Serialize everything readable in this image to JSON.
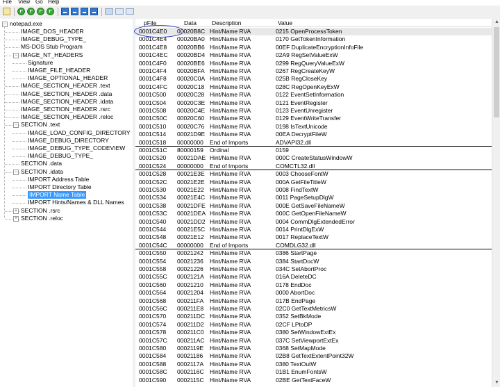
{
  "menu": [
    "File",
    "View",
    "Go",
    "Help"
  ],
  "tree": {
    "root": "notepad.exe",
    "items": [
      {
        "label": "IMAGE_DOS_HEADER",
        "level": 1
      },
      {
        "label": "IMAGE_DEBUG_TYPE_",
        "level": 1
      },
      {
        "label": "MS-DOS Stub Program",
        "level": 1
      },
      {
        "label": "IMAGE_NT_HEADERS",
        "level": 1
      },
      {
        "label": "Signature",
        "level": 2
      },
      {
        "label": "IMAGE_FILE_HEADER",
        "level": 2
      },
      {
        "label": "IMAGE_OPTIONAL_HEADER",
        "level": 2
      },
      {
        "label": "IMAGE_SECTION_HEADER .text",
        "level": 1
      },
      {
        "label": "IMAGE_SECTION_HEADER .data",
        "level": 1
      },
      {
        "label": "IMAGE_SECTION_HEADER .idata",
        "level": 1
      },
      {
        "label": "IMAGE_SECTION_HEADER .rsrc",
        "level": 1
      },
      {
        "label": "IMAGE_SECTION_HEADER .reloc",
        "level": 1
      },
      {
        "label": "SECTION .text",
        "level": 1
      },
      {
        "label": "IMAGE_LOAD_CONFIG_DIRECTORY",
        "level": 2
      },
      {
        "label": "IMAGE_DEBUG_DIRECTORY",
        "level": 2
      },
      {
        "label": "IMAGE_DEBUG_TYPE_CODEVIEW",
        "level": 2
      },
      {
        "label": "IMAGE_DEBUG_TYPE_",
        "level": 2
      },
      {
        "label": "SECTION .data",
        "level": 1
      },
      {
        "label": "SECTION .idata",
        "level": 1
      },
      {
        "label": "IMPORT Address Table",
        "level": 2
      },
      {
        "label": "IMPORT Directory Table",
        "level": 2
      },
      {
        "label": "IMPORT Name Table",
        "level": 2,
        "selected": true
      },
      {
        "label": "IMPORT Hints/Names & DLL Names",
        "level": 2
      },
      {
        "label": "SECTION .rsrc",
        "level": 1
      },
      {
        "label": "SECTION .reloc",
        "level": 1
      }
    ]
  },
  "columns": [
    "pFile",
    "Data",
    "Description",
    "Value"
  ],
  "rows": [
    [
      "0001C4E0",
      "00020B8C",
      "Hint/Name RVA",
      "0215  OpenProcessToken"
    ],
    [
      "0001C4E4",
      "00020BA0",
      "Hint/Name RVA",
      "0170  GetTokenInformation"
    ],
    [
      "0001C4E8",
      "00020BB6",
      "Hint/Name RVA",
      "00EF  DuplicateEncryptionInfoFile"
    ],
    [
      "0001C4EC",
      "00020BD4",
      "Hint/Name RVA",
      "02A9  RegSetValueExW"
    ],
    [
      "0001C4F0",
      "00020BE6",
      "Hint/Name RVA",
      "0299  RegQueryValueExW"
    ],
    [
      "0001C4F4",
      "00020BFA",
      "Hint/Name RVA",
      "0267  RegCreateKeyW"
    ],
    [
      "0001C4F8",
      "00020C0A",
      "Hint/Name RVA",
      "025B  RegCloseKey"
    ],
    [
      "0001C4FC",
      "00020C18",
      "Hint/Name RVA",
      "028C  RegOpenKeyExW"
    ],
    [
      "0001C500",
      "00020C28",
      "Hint/Name RVA",
      "0122  EventSetInformation"
    ],
    [
      "0001C504",
      "00020C3E",
      "Hint/Name RVA",
      "0121  EventRegister"
    ],
    [
      "0001C508",
      "00020C4E",
      "Hint/Name RVA",
      "0123  EventUnregister"
    ],
    [
      "0001C50C",
      "00020C60",
      "Hint/Name RVA",
      "0129  EventWriteTransfer"
    ],
    [
      "0001C510",
      "00020C76",
      "Hint/Name RVA",
      "0198  IsTextUnicode"
    ],
    [
      "0001C514",
      "00021D9E",
      "Hint/Name RVA",
      "00EA  DecryptFileW"
    ],
    [
      "0001C518",
      "00000000",
      "End of Imports",
      "ADVAPI32.dll"
    ],
    [
      "0001C51C",
      "80000159",
      "Ordinal",
      "0159"
    ],
    [
      "0001C520",
      "00021DAE",
      "Hint/Name RVA",
      "000C  CreateStatusWindowW"
    ],
    [
      "0001C524",
      "00000000",
      "End of Imports",
      "COMCTL32.dll"
    ],
    [
      "0001C528",
      "00021E3E",
      "Hint/Name RVA",
      "0003  ChooseFontW"
    ],
    [
      "0001C52C",
      "00021E2E",
      "Hint/Name RVA",
      "000A  GetFileTitleW"
    ],
    [
      "0001C530",
      "00021E22",
      "Hint/Name RVA",
      "0008  FindTextW"
    ],
    [
      "0001C534",
      "00021E4C",
      "Hint/Name RVA",
      "0011  PageSetupDlgW"
    ],
    [
      "0001C538",
      "00021DFE",
      "Hint/Name RVA",
      "000E  GetSaveFileNameW"
    ],
    [
      "0001C53C",
      "00021DEA",
      "Hint/Name RVA",
      "000C  GetOpenFileNameW"
    ],
    [
      "0001C540",
      "00021DD2",
      "Hint/Name RVA",
      "0004  CommDlgExtendedError"
    ],
    [
      "0001C544",
      "00021E5C",
      "Hint/Name RVA",
      "0014  PrintDlgExW"
    ],
    [
      "0001C548",
      "00021E12",
      "Hint/Name RVA",
      "0017  ReplaceTextW"
    ],
    [
      "0001C54C",
      "00000000",
      "End of Imports",
      "COMDLG32.dll"
    ],
    [
      "0001C550",
      "00021242",
      "Hint/Name RVA",
      "0386  StartPage"
    ],
    [
      "0001C554",
      "00021236",
      "Hint/Name RVA",
      "0384  StartDocW"
    ],
    [
      "0001C558",
      "00021226",
      "Hint/Name RVA",
      "034C  SetAbortProc"
    ],
    [
      "0001C55C",
      "0002121A",
      "Hint/Name RVA",
      "016A  DeleteDC"
    ],
    [
      "0001C560",
      "00021210",
      "Hint/Name RVA",
      "0178  EndDoc"
    ],
    [
      "0001C564",
      "00021204",
      "Hint/Name RVA",
      "0000  AbortDoc"
    ],
    [
      "0001C568",
      "000211FA",
      "Hint/Name RVA",
      "017B  EndPage"
    ],
    [
      "0001C56C",
      "000211E8",
      "Hint/Name RVA",
      "02C0  GetTextMetricsW"
    ],
    [
      "0001C570",
      "000211DC",
      "Hint/Name RVA",
      "0352  SetBkMode"
    ],
    [
      "0001C574",
      "000211D2",
      "Hint/Name RVA",
      "02CF  LPtoDP"
    ],
    [
      "0001C578",
      "000211C0",
      "Hint/Name RVA",
      "0380  SetWindowExtEx"
    ],
    [
      "0001C57C",
      "000211AC",
      "Hint/Name RVA",
      "037C  SetViewportExtEx"
    ],
    [
      "0001C580",
      "0002119E",
      "Hint/Name RVA",
      "0368  SetMapMode"
    ],
    [
      "0001C584",
      "00021186",
      "Hint/Name RVA",
      "02B8  GetTextExtentPoint32W"
    ],
    [
      "0001C588",
      "0002117A",
      "Hint/Name RVA",
      "0380  TextOutW"
    ],
    [
      "0001C58C",
      "0002116C",
      "Hint/Name RVA",
      "01B1  EnumFontsW"
    ],
    [
      "0001C590",
      "0002115C",
      "Hint/Name RVA",
      "02BE  GetTextFaceW"
    ]
  ],
  "group_separators_after": [
    14,
    17,
    27
  ],
  "selected_row": 0,
  "colors": {
    "selection": "#3399ff",
    "annotation": "#2b3dc9"
  }
}
